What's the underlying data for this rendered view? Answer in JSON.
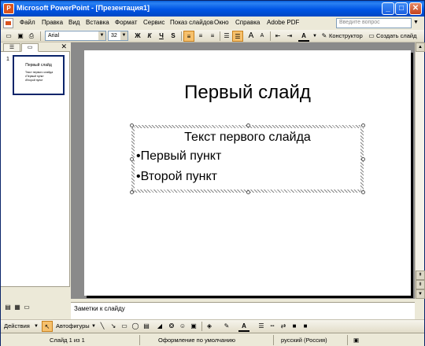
{
  "window": {
    "title": "Microsoft PowerPoint - [Презентация1]",
    "minimize": "_",
    "maximize": "□",
    "close": "✕"
  },
  "menu": {
    "items": [
      "Файл",
      "Правка",
      "Вид",
      "Вставка",
      "Формат",
      "Сервис",
      "Показ слайдов",
      "Окно",
      "Справка",
      "Adobe PDF"
    ],
    "help_placeholder": "Введите вопрос"
  },
  "toolbar": {
    "font": "Arial",
    "font_size": "32",
    "bold": "Ж",
    "italic": "К",
    "underline": "Ч",
    "shadow": "S",
    "font_grow": "A",
    "font_shrink": "A",
    "font_color": "A",
    "designer_label": "Конструктор",
    "new_slide_label": "Создать слайд"
  },
  "slides_pane": {
    "thumb_number": "1",
    "thumb_title": "Первый слайд",
    "thumb_lines": [
      "Текст первого слайда",
      "•Первый пункт",
      "•Второй пункт"
    ]
  },
  "slide": {
    "title": "Первый слайд",
    "textbox_title": "Текст первого слайда",
    "bullets": [
      "•Первый пункт",
      "•Второй пункт"
    ]
  },
  "notes": {
    "placeholder": "Заметки к слайду"
  },
  "drawing_toolbar": {
    "actions_label": "Действия",
    "autoshapes_label": "Автофигуры"
  },
  "status": {
    "slide_info": "Слайд 1 из 1",
    "design": "Оформление по умолчанию",
    "language": "русский (Россия)"
  }
}
